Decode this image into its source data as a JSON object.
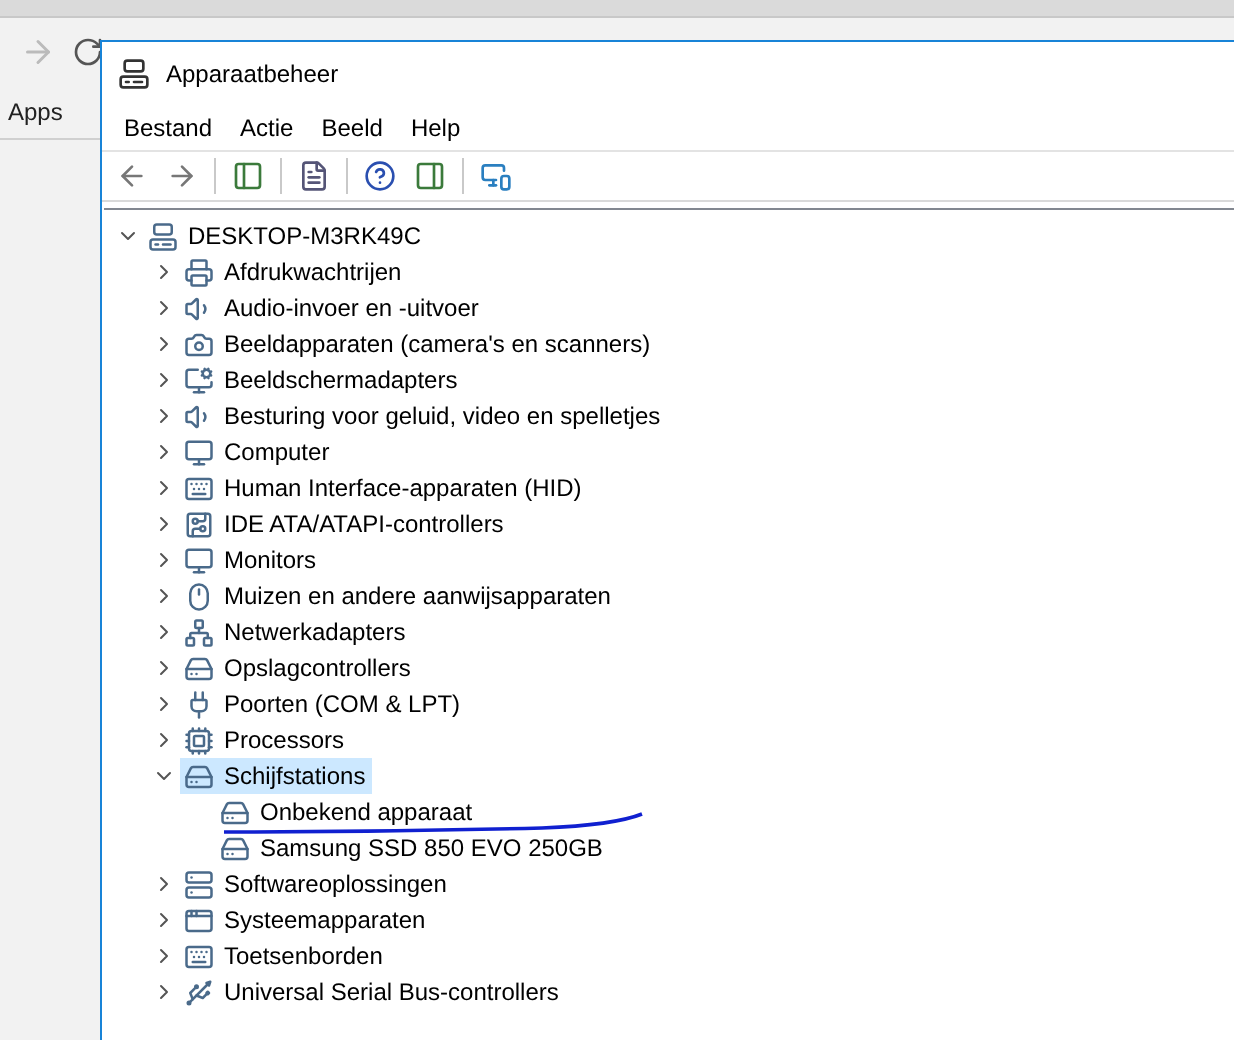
{
  "browser": {
    "bookmarks": [
      "Apps"
    ]
  },
  "window": {
    "title": "Apparaatbeheer"
  },
  "menu": [
    "Bestand",
    "Actie",
    "Beeld",
    "Help"
  ],
  "tree": {
    "label": "DESKTOP-M3RK49C",
    "expanded": true,
    "selected": false,
    "children": [
      {
        "label": "Afdrukwachtrijen",
        "expanded": false,
        "selected": false
      },
      {
        "label": "Audio-invoer en -uitvoer",
        "expanded": false,
        "selected": false
      },
      {
        "label": "Beeldapparaten (camera's en scanners)",
        "expanded": false,
        "selected": false
      },
      {
        "label": "Beeldschermadapters",
        "expanded": false,
        "selected": false
      },
      {
        "label": "Besturing voor geluid, video en spelletjes",
        "expanded": false,
        "selected": false
      },
      {
        "label": "Computer",
        "expanded": false,
        "selected": false
      },
      {
        "label": "Human Interface-apparaten (HID)",
        "expanded": false,
        "selected": false
      },
      {
        "label": "IDE ATA/ATAPI-controllers",
        "expanded": false,
        "selected": false
      },
      {
        "label": "Monitors",
        "expanded": false,
        "selected": false
      },
      {
        "label": "Muizen en andere aanwijsapparaten",
        "expanded": false,
        "selected": false
      },
      {
        "label": "Netwerkadapters",
        "expanded": false,
        "selected": false
      },
      {
        "label": "Opslagcontrollers",
        "expanded": false,
        "selected": false
      },
      {
        "label": "Poorten (COM & LPT)",
        "expanded": false,
        "selected": false
      },
      {
        "label": "Processors",
        "expanded": false,
        "selected": false
      },
      {
        "label": "Schijfstations",
        "expanded": true,
        "selected": true,
        "children": [
          {
            "label": "Onbekend apparaat",
            "selected": false
          },
          {
            "label": "Samsung SSD 850 EVO 250GB",
            "selected": false
          }
        ]
      },
      {
        "label": "Softwareoplossingen",
        "expanded": false,
        "selected": false
      },
      {
        "label": "Systeemapparaten",
        "expanded": false,
        "selected": false
      },
      {
        "label": "Toetsenborden",
        "expanded": false,
        "selected": false
      },
      {
        "label": "Universal Serial Bus-controllers",
        "expanded": false,
        "selected": false
      }
    ]
  }
}
